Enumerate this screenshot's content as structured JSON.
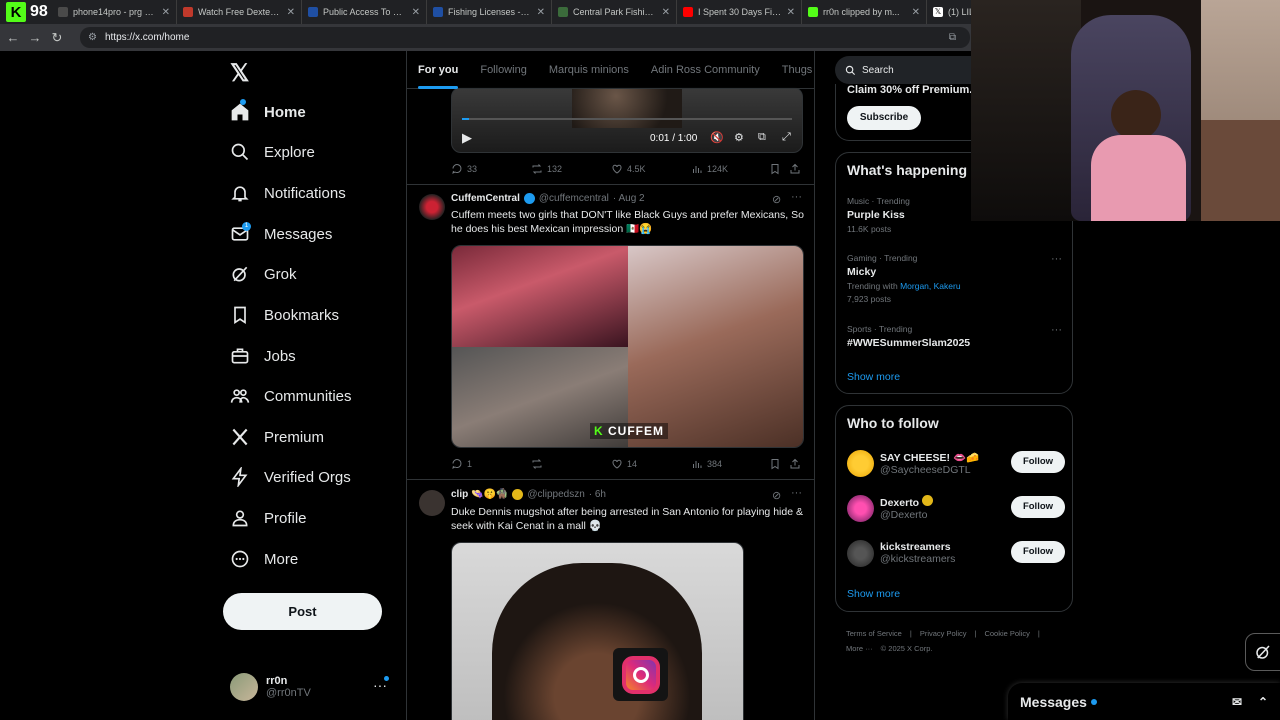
{
  "overlay": {
    "kick_number": "98"
  },
  "browser": {
    "tabs": [
      {
        "title": "phone14pro - prg co...",
        "fav": "#4a4a4a"
      },
      {
        "title": "Watch Free Dexter HD",
        "fav": "#c0392b"
      },
      {
        "title": "Public Access To New Y...",
        "fav": "#1f4fa3"
      },
      {
        "title": "Fishing Licenses - NYS...",
        "fav": "#1f4fa3"
      },
      {
        "title": "Central Park Fishing : N...",
        "fav": "#3b6b3b"
      },
      {
        "title": "I Spent 30 Days Fishing...",
        "fav": "#ff0000"
      },
      {
        "title": "rr0n clipped by m...",
        "fav": "#53fc18"
      },
      {
        "title": "(1) LIL TAY o...",
        "fav": "#000000"
      }
    ],
    "url": "https://x.com/home"
  },
  "nav": {
    "items": [
      {
        "label": "Home",
        "icon": "home-icon"
      },
      {
        "label": "Explore",
        "icon": "search-icon"
      },
      {
        "label": "Notifications",
        "icon": "bell-icon"
      },
      {
        "label": "Messages",
        "icon": "mail-icon",
        "badge": "1"
      },
      {
        "label": "Grok",
        "icon": "grok-icon"
      },
      {
        "label": "Bookmarks",
        "icon": "bookmark-icon"
      },
      {
        "label": "Jobs",
        "icon": "briefcase-icon"
      },
      {
        "label": "Communities",
        "icon": "people-icon"
      },
      {
        "label": "Premium",
        "icon": "x-icon"
      },
      {
        "label": "Verified Orgs",
        "icon": "lightning-icon"
      },
      {
        "label": "Profile",
        "icon": "person-icon"
      },
      {
        "label": "More",
        "icon": "more-circle-icon"
      }
    ],
    "post_label": "Post",
    "account": {
      "name": "rr0n",
      "handle": "@rr0nTV"
    }
  },
  "feed": {
    "tabs": [
      "For you",
      "Following",
      "Marquis minions",
      "Adin Ross Community",
      "Thugs NS"
    ],
    "video_time": "0:01 / 1:00",
    "tweet0_stats": {
      "replies": "33",
      "reposts": "132",
      "likes": "4.5K",
      "views": "124K"
    },
    "tweet1": {
      "name": "CuffemCentral",
      "handle": "@cuffemcentral",
      "time": "· Aug 2",
      "text": "Cuffem meets two girls that DON'T like Black Guys and prefer Mexicans, So he does his best Mexican impression 🇲🇽😭",
      "watermark": "CUFFEM",
      "stats": {
        "replies": "1",
        "reposts": "",
        "likes": "14",
        "views": "384"
      }
    },
    "tweet2": {
      "name": "clip 👒🤫🧌",
      "handle": "@clippedszn",
      "time": "· 6h",
      "text": "Duke Dennis mugshot after being arrested in San Antonio for playing hide & seek with Kai Cenat in a mall 💀"
    }
  },
  "sidebar": {
    "search_placeholder": "Search",
    "premium_text": "Claim 30% off Premium. E",
    "subscribe_label": "Subscribe",
    "happening_title": "What's happening",
    "trends": [
      {
        "context": "Music · Trending",
        "title": "Purple Kiss",
        "count": "11.6K posts",
        "with": ""
      },
      {
        "context": "Gaming · Trending",
        "title": "Micky",
        "count": "7,923 posts",
        "with_prefix": "Trending with",
        "with": "Morgan, Kakeru"
      },
      {
        "context": "Sports · Trending",
        "title": "#WWESummerSlam2025",
        "count": ""
      }
    ],
    "show_more": "Show more",
    "follow_title": "Who to follow",
    "who_to_follow": [
      {
        "name": "SAY CHEESE! 👄🧀",
        "handle": "@SaycheeseDGTL",
        "button": "Follow"
      },
      {
        "name": "Dexerto",
        "handle": "@Dexerto",
        "button": "Follow"
      },
      {
        "name": "kickstreamers",
        "handle": "@kickstreamers",
        "button": "Follow"
      }
    ],
    "footer": [
      "Terms of Service",
      "|",
      "Privacy Policy",
      "|",
      "Cookie Policy",
      "|",
      "More ···",
      "© 2025 X Corp."
    ]
  },
  "messages_drawer": {
    "label": "Messages"
  },
  "colors": {
    "accent": "#1d9bf0",
    "kick_green": "#53fc18",
    "bg": "#000000",
    "border": "#2f3336"
  }
}
